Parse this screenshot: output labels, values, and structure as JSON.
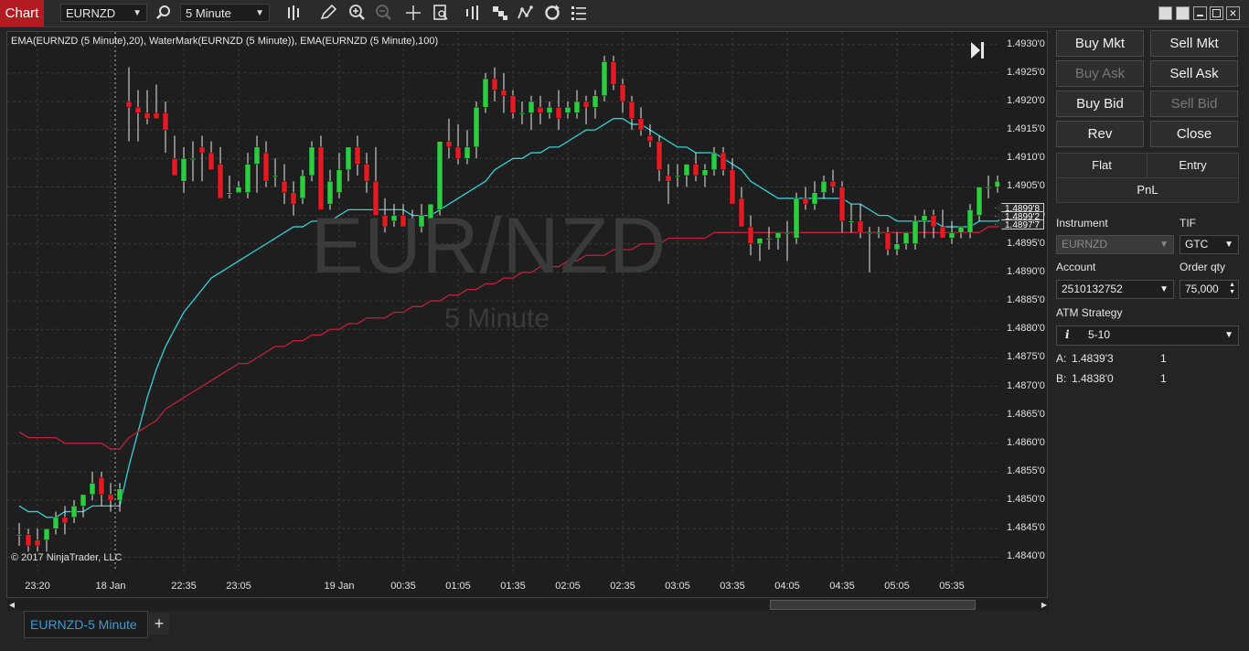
{
  "toolbar": {
    "app_label": "Chart",
    "instrument": "EURNZD",
    "interval": "5 Minute",
    "icons": [
      "search-icon",
      "bar-type-icon",
      "drawing-pencil-icon",
      "zoom-in-icon",
      "zoom-out-icon",
      "crosshair-icon",
      "data-box-icon",
      "indicators-icon",
      "strategies-icon",
      "chart-trader-icon",
      "reload-icon",
      "properties-icon"
    ]
  },
  "chart": {
    "indicator_label": "EMA(EURNZD (5 Minute),20), WaterMark(EURNZD (5 Minute)), EMA(EURNZD (5 Minute),100)",
    "watermark_main": "EUR/NZD",
    "watermark_sub": "5 Minute",
    "copyright": "© 2017 NinjaTrader, LLC",
    "price_tags": [
      "1.4899'8",
      "1.4899'2",
      "1.4897'7"
    ],
    "colors": {
      "background": "#1e1e1e",
      "up": "#2ecc40",
      "down": "#e31a22",
      "ema20": "#33d1d6",
      "ema100": "#c0203a"
    }
  },
  "chart_data": {
    "type": "candlestick",
    "y_ticks": [
      "1.4930'0",
      "1.4925'0",
      "1.4920'0",
      "1.4915'0",
      "1.4910'0",
      "1.4905'0",
      "1.4900'0",
      "1.4895'0",
      "1.4890'0",
      "1.4885'0",
      "1.4880'0",
      "1.4875'0",
      "1.4870'0",
      "1.4865'0",
      "1.4860'0",
      "1.4855'0",
      "1.4850'0",
      "1.4845'0",
      "1.4840'0"
    ],
    "y_tick_values": [
      1.493,
      1.4925,
      1.492,
      1.4915,
      1.491,
      1.4905,
      1.49,
      1.4895,
      1.489,
      1.4885,
      1.488,
      1.4875,
      1.487,
      1.4865,
      1.486,
      1.4855,
      1.485,
      1.4845,
      1.484
    ],
    "ylim": [
      1.48375,
      1.49322
    ],
    "x_ticks": [
      "23:20",
      "18 Jan",
      "22:35",
      "23:05",
      "19 Jan",
      "00:35",
      "01:05",
      "01:35",
      "02:05",
      "02:35",
      "03:05",
      "03:35",
      "04:05",
      "04:35",
      "05:05",
      "05:35"
    ],
    "x_tick_bars": [
      2,
      10,
      18,
      24,
      35,
      42,
      48,
      54,
      60,
      66,
      72,
      78,
      84,
      90,
      96,
      102
    ],
    "session_break_bar": 11,
    "candles": [
      [
        1.4844,
        1.4846,
        1.4842,
        1.4844
      ],
      [
        1.4844,
        1.4845,
        1.4841,
        1.4842
      ],
      [
        1.4843,
        1.4845,
        1.4841,
        1.4842
      ],
      [
        1.4843,
        1.4845,
        1.4841,
        1.4845
      ],
      [
        1.4845,
        1.4848,
        1.4844,
        1.4847
      ],
      [
        1.4847,
        1.4849,
        1.4844,
        1.4846
      ],
      [
        1.4847,
        1.485,
        1.4846,
        1.4849
      ],
      [
        1.4849,
        1.4851,
        1.4847,
        1.4851
      ],
      [
        1.4851,
        1.4855,
        1.485,
        1.4853
      ],
      [
        1.4854,
        1.4855,
        1.4849,
        1.4851
      ],
      [
        1.4851,
        1.4853,
        1.4848,
        1.485
      ],
      [
        1.485,
        1.4853,
        1.4848,
        1.4852
      ],
      [
        1.492,
        1.4926,
        1.4913,
        1.4919
      ],
      [
        1.4919,
        1.4922,
        1.4913,
        1.4918
      ],
      [
        1.4918,
        1.4922,
        1.4916,
        1.4917
      ],
      [
        1.4918,
        1.4923,
        1.4917,
        1.4917
      ],
      [
        1.4918,
        1.492,
        1.4911,
        1.4915
      ],
      [
        1.491,
        1.4914,
        1.4908,
        1.4907
      ],
      [
        1.4906,
        1.4912,
        1.4904,
        1.491
      ],
      [
        1.491,
        1.4913,
        1.4906,
        1.491
      ],
      [
        1.4912,
        1.4914,
        1.4906,
        1.4911
      ],
      [
        1.4911,
        1.4913,
        1.4908,
        1.4908
      ],
      [
        1.4909,
        1.4912,
        1.4903,
        1.4903
      ],
      [
        1.4904,
        1.4907,
        1.4903,
        1.4904
      ],
      [
        1.4904,
        1.4906,
        1.4904,
        1.4905
      ],
      [
        1.4904,
        1.4911,
        1.4903,
        1.4909
      ],
      [
        1.4909,
        1.4914,
        1.4904,
        1.4912
      ],
      [
        1.4911,
        1.4913,
        1.4905,
        1.4906
      ],
      [
        1.4907,
        1.491,
        1.4905,
        1.4907
      ],
      [
        1.4906,
        1.4909,
        1.4902,
        1.4904
      ],
      [
        1.4904,
        1.4906,
        1.49,
        1.4902
      ],
      [
        1.4903,
        1.4908,
        1.4902,
        1.4907
      ],
      [
        1.4907,
        1.4913,
        1.4906,
        1.4912
      ],
      [
        1.4912,
        1.4914,
        1.4901,
        1.4901
      ],
      [
        1.4902,
        1.4908,
        1.4901,
        1.4906
      ],
      [
        1.4904,
        1.4911,
        1.4903,
        1.4908
      ],
      [
        1.4908,
        1.4911,
        1.4906,
        1.4912
      ],
      [
        1.4912,
        1.4914,
        1.4907,
        1.4909
      ],
      [
        1.4909,
        1.4911,
        1.4904,
        1.4906
      ],
      [
        1.4906,
        1.4912,
        1.49,
        1.49
      ],
      [
        1.49,
        1.4903,
        1.4897,
        1.4898
      ],
      [
        1.4899,
        1.4902,
        1.4898,
        1.49
      ],
      [
        1.49,
        1.4902,
        1.4898,
        1.4898
      ],
      [
        1.4898,
        1.4901,
        1.4896,
        1.4897
      ],
      [
        1.4898,
        1.4902,
        1.4897,
        1.49
      ],
      [
        1.4899,
        1.4902,
        1.4898,
        1.4902
      ],
      [
        1.4901,
        1.4911,
        1.49,
        1.4913
      ],
      [
        1.4913,
        1.4917,
        1.491,
        1.4912
      ],
      [
        1.4912,
        1.4916,
        1.4909,
        1.491
      ],
      [
        1.491,
        1.4915,
        1.4909,
        1.4912
      ],
      [
        1.4912,
        1.492,
        1.491,
        1.4919
      ],
      [
        1.4919,
        1.4925,
        1.4918,
        1.4924
      ],
      [
        1.4924,
        1.4926,
        1.492,
        1.4922
      ],
      [
        1.4922,
        1.4925,
        1.4918,
        1.4921
      ],
      [
        1.4921,
        1.4922,
        1.4917,
        1.4918
      ],
      [
        1.4918,
        1.492,
        1.4916,
        1.4918
      ],
      [
        1.4918,
        1.4921,
        1.4915,
        1.492
      ],
      [
        1.4919,
        1.4921,
        1.4916,
        1.4918
      ],
      [
        1.4918,
        1.492,
        1.4917,
        1.4919
      ],
      [
        1.4919,
        1.4922,
        1.4915,
        1.4917
      ],
      [
        1.4918,
        1.492,
        1.4917,
        1.4919
      ],
      [
        1.4918,
        1.4922,
        1.4917,
        1.492
      ],
      [
        1.492,
        1.4921,
        1.4916,
        1.4919
      ],
      [
        1.4919,
        1.4922,
        1.4917,
        1.4921
      ],
      [
        1.4921,
        1.4928,
        1.492,
        1.4927
      ],
      [
        1.4927,
        1.4928,
        1.4922,
        1.4923
      ],
      [
        1.4923,
        1.4924,
        1.4918,
        1.492
      ],
      [
        1.492,
        1.4921,
        1.4915,
        1.4917
      ],
      [
        1.4917,
        1.4919,
        1.4914,
        1.4915
      ],
      [
        1.4914,
        1.4916,
        1.4912,
        1.4913
      ],
      [
        1.4913,
        1.4914,
        1.4906,
        1.4908
      ],
      [
        1.4907,
        1.4909,
        1.4902,
        1.4906
      ],
      [
        1.4907,
        1.4909,
        1.4905,
        1.4907
      ],
      [
        1.4907,
        1.4909,
        1.4905,
        1.4909
      ],
      [
        1.4909,
        1.4911,
        1.4906,
        1.4907
      ],
      [
        1.4907,
        1.4909,
        1.4905,
        1.4908
      ],
      [
        1.4908,
        1.4912,
        1.4907,
        1.4911
      ],
      [
        1.4911,
        1.4912,
        1.4907,
        1.4908
      ],
      [
        1.4908,
        1.491,
        1.4902,
        1.4902
      ],
      [
        1.4903,
        1.4905,
        1.4898,
        1.4898
      ],
      [
        1.4898,
        1.49,
        1.4893,
        1.4895
      ],
      [
        1.4895,
        1.4896,
        1.4892,
        1.4896
      ],
      [
        1.4896,
        1.4898,
        1.4894,
        1.4896
      ],
      [
        1.4896,
        1.4897,
        1.4894,
        1.4897
      ],
      [
        1.4897,
        1.4899,
        1.4892,
        1.4897
      ],
      [
        1.4896,
        1.4904,
        1.4895,
        1.4903
      ],
      [
        1.4903,
        1.4905,
        1.4901,
        1.4902
      ],
      [
        1.4902,
        1.4906,
        1.4901,
        1.4904
      ],
      [
        1.4904,
        1.4907,
        1.4903,
        1.4906
      ],
      [
        1.4906,
        1.4908,
        1.4904,
        1.4905
      ],
      [
        1.4905,
        1.4906,
        1.4897,
        1.4899
      ],
      [
        1.4899,
        1.4902,
        1.4897,
        1.4899
      ],
      [
        1.4899,
        1.4902,
        1.4896,
        1.4897
      ],
      [
        1.4897,
        1.4898,
        1.489,
        1.4897
      ],
      [
        1.4897,
        1.4898,
        1.4896,
        1.4897
      ],
      [
        1.4897,
        1.4898,
        1.4893,
        1.4894
      ],
      [
        1.4894,
        1.4897,
        1.4893,
        1.4895
      ],
      [
        1.4895,
        1.4897,
        1.4894,
        1.4897
      ],
      [
        1.4895,
        1.49,
        1.4894,
        1.4899
      ],
      [
        1.4899,
        1.4901,
        1.4896,
        1.49
      ],
      [
        1.49,
        1.4901,
        1.4896,
        1.4898
      ],
      [
        1.4898,
        1.4901,
        1.4897,
        1.4896
      ],
      [
        1.4896,
        1.4899,
        1.4895,
        1.4897
      ],
      [
        1.4897,
        1.4898,
        1.4896,
        1.4898
      ],
      [
        1.4897,
        1.4902,
        1.4896,
        1.4901
      ],
      [
        1.49,
        1.4905,
        1.4899,
        1.4905
      ],
      [
        1.4905,
        1.4907,
        1.4903,
        1.4905
      ],
      [
        1.4905,
        1.4907,
        1.4904,
        1.4906
      ],
      [
        1.4906,
        1.4908,
        1.4903,
        1.4904
      ],
      [
        1.4904,
        1.4905,
        1.4898,
        1.4899
      ]
    ],
    "series": [
      {
        "name": "EMA(EURNZD (5 Minute),20)",
        "color": "#33d1d6",
        "values": [
          1.4849,
          1.4848,
          1.4848,
          1.4847,
          1.4847,
          1.4848,
          1.4848,
          1.4848,
          1.4849,
          1.4849,
          1.4849,
          1.4849,
          1.4856,
          1.4862,
          1.4868,
          1.4873,
          1.4877,
          1.488,
          1.4883,
          1.4885,
          1.4887,
          1.4889,
          1.489,
          1.4891,
          1.4892,
          1.4893,
          1.4894,
          1.4895,
          1.4896,
          1.4897,
          1.4898,
          1.4898,
          1.4899,
          1.4899,
          1.4899,
          1.49,
          1.4901,
          1.4901,
          1.4901,
          1.4901,
          1.4901,
          1.4901,
          1.4901,
          1.49,
          1.49,
          1.49,
          1.4901,
          1.4902,
          1.4903,
          1.4904,
          1.4905,
          1.4906,
          1.4908,
          1.4909,
          1.491,
          1.491,
          1.4911,
          1.4911,
          1.4912,
          1.4912,
          1.4913,
          1.4914,
          1.4915,
          1.4915,
          1.4916,
          1.4917,
          1.4917,
          1.4916,
          1.4916,
          1.4915,
          1.4914,
          1.4913,
          1.4912,
          1.4912,
          1.4911,
          1.4911,
          1.4911,
          1.491,
          1.4909,
          1.4908,
          1.4906,
          1.4905,
          1.4904,
          1.4903,
          1.4903,
          1.4903,
          1.4903,
          1.4903,
          1.4903,
          1.4903,
          1.4903,
          1.4902,
          1.4902,
          1.4901,
          1.49,
          1.49,
          1.4899,
          1.4899,
          1.4899,
          1.4899,
          1.4899,
          1.4898,
          1.4898,
          1.4898,
          1.4898,
          1.4899,
          1.4899,
          1.4899,
          1.49,
          1.49,
          1.49
        ]
      },
      {
        "name": "EMA(EURNZD (5 Minute),100)",
        "color": "#c0203a",
        "values": [
          1.4862,
          1.4861,
          1.4861,
          1.4861,
          1.4861,
          1.486,
          1.486,
          1.486,
          1.486,
          1.486,
          1.4859,
          1.4859,
          1.4861,
          1.4862,
          1.4863,
          1.4864,
          1.4866,
          1.4867,
          1.4868,
          1.4869,
          1.487,
          1.4871,
          1.4872,
          1.4873,
          1.4874,
          1.4874,
          1.4875,
          1.4876,
          1.4877,
          1.4877,
          1.4878,
          1.4878,
          1.4879,
          1.4879,
          1.488,
          1.488,
          1.4881,
          1.4881,
          1.4882,
          1.4882,
          1.4882,
          1.4883,
          1.4883,
          1.4884,
          1.4884,
          1.4885,
          1.4885,
          1.4886,
          1.4886,
          1.4887,
          1.4887,
          1.4888,
          1.4888,
          1.4889,
          1.4889,
          1.489,
          1.489,
          1.4891,
          1.4891,
          1.4891,
          1.4892,
          1.4892,
          1.4893,
          1.4893,
          1.4893,
          1.4894,
          1.4894,
          1.4894,
          1.4895,
          1.4895,
          1.4895,
          1.4896,
          1.4896,
          1.4896,
          1.4896,
          1.4896,
          1.4897,
          1.4897,
          1.4897,
          1.4897,
          1.4897,
          1.4897,
          1.4897,
          1.4897,
          1.4897,
          1.4897,
          1.4897,
          1.4897,
          1.4897,
          1.4897,
          1.4897,
          1.4897,
          1.4897,
          1.4897,
          1.4897,
          1.4897,
          1.4897,
          1.4897,
          1.4897,
          1.4897,
          1.4897,
          1.4897,
          1.4897,
          1.4897,
          1.4897,
          1.4897,
          1.4898,
          1.4898,
          1.4898,
          1.4898,
          1.4898
        ]
      }
    ]
  },
  "bottom": {
    "tab_label": "EURNZD-5 Minute",
    "add_tab": "+"
  },
  "order": {
    "buy_mkt": "Buy Mkt",
    "sell_mkt": "Sell Mkt",
    "buy_ask": "Buy Ask",
    "sell_ask": "Sell Ask",
    "buy_bid": "Buy Bid",
    "sell_bid": "Sell Bid",
    "rev": "Rev",
    "close": "Close",
    "flat": "Flat",
    "entry": "Entry",
    "pnl": "PnL",
    "instrument_label": "Instrument",
    "instrument_value": "EURNZD",
    "tif_label": "TIF",
    "tif_value": "GTC",
    "account_label": "Account",
    "account_value": "2510132752",
    "qty_label": "Order qty",
    "qty_value": "75,000",
    "atm_label": "ATM Strategy",
    "atm_value": "5-10",
    "ask_label": "A:",
    "ask_price": "1.4839'3",
    "ask_size": "1",
    "bid_label": "B:",
    "bid_price": "1.4838'0",
    "bid_size": "1"
  }
}
